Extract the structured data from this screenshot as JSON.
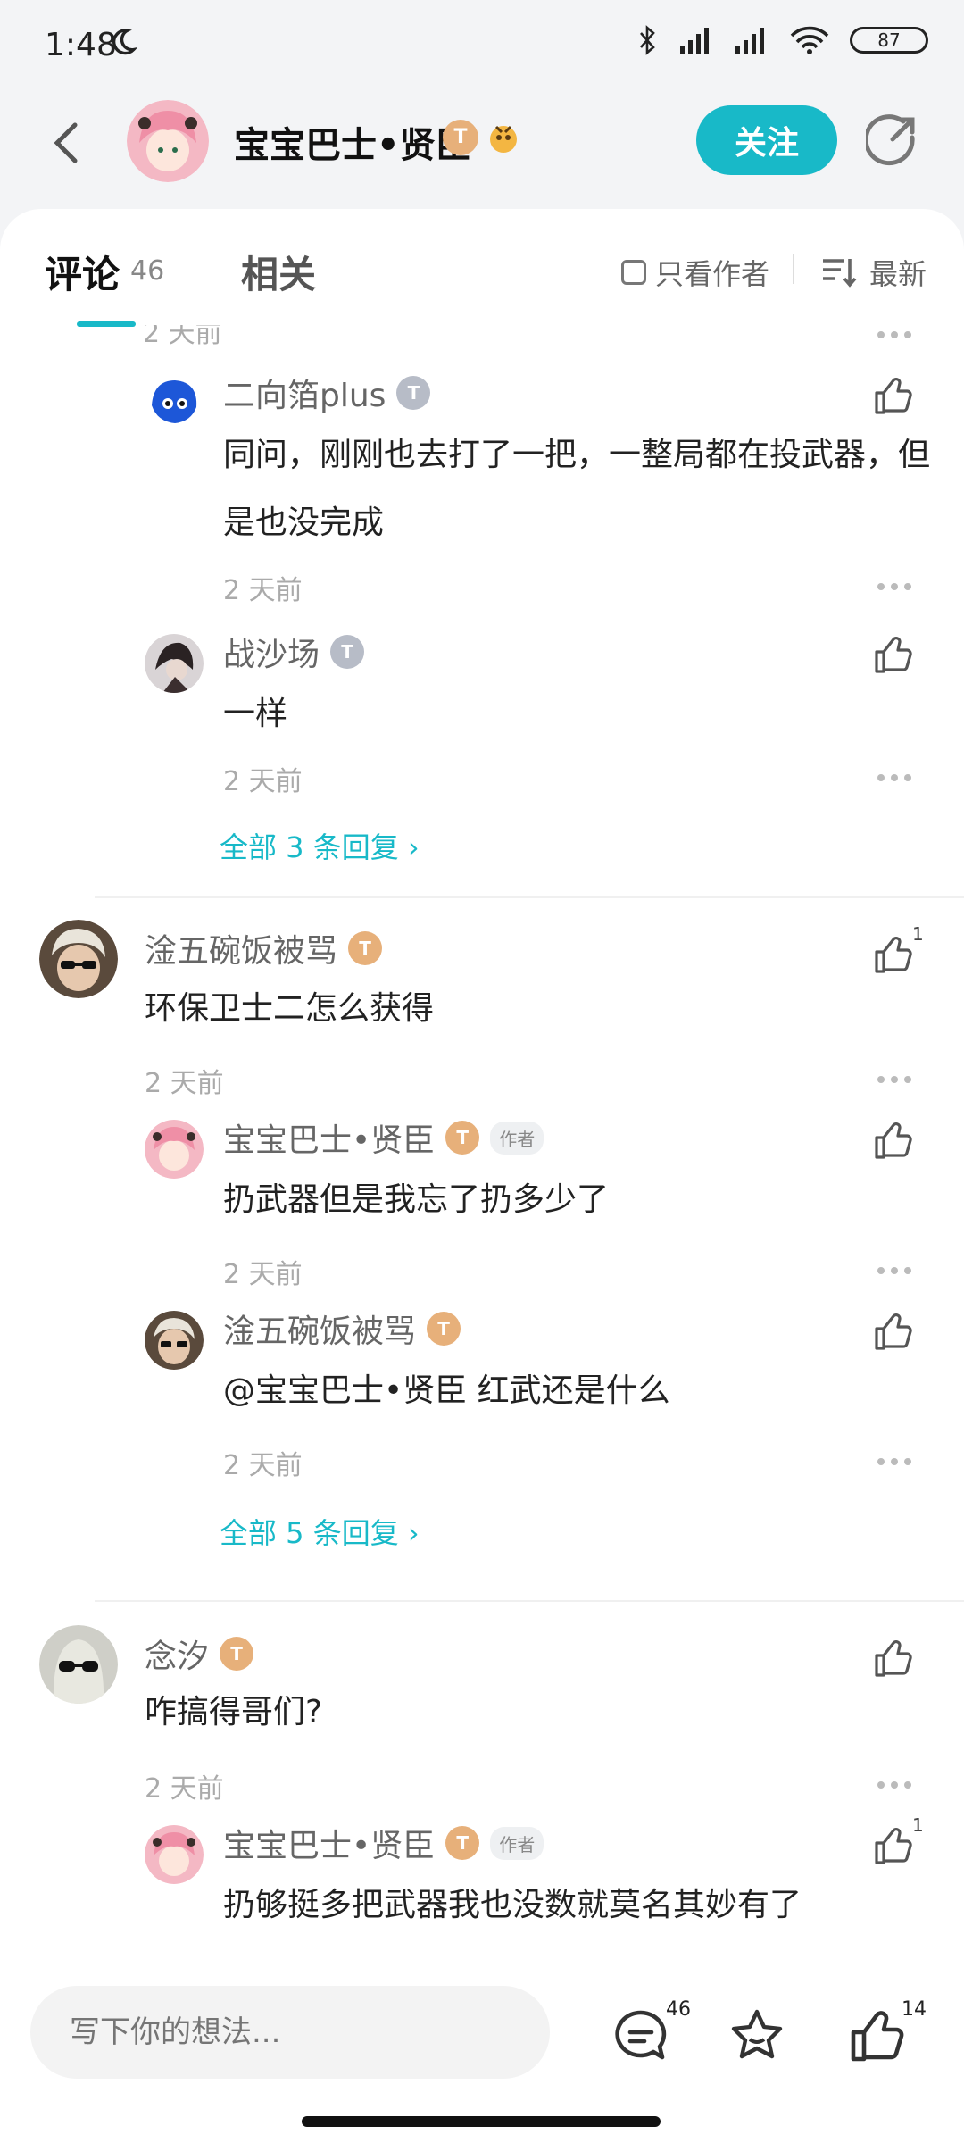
{
  "status": {
    "time": "1:48",
    "battery": "87"
  },
  "header": {
    "name": "宝宝巴士•贤臣",
    "badge": "T",
    "follow_label": "关注"
  },
  "tabs": {
    "comment_label": "评论",
    "comment_count": "46",
    "related_label": "相关",
    "author_only_label": "只看作者",
    "sort_label": "最新"
  },
  "comments": [
    {
      "name": "二向箔plus",
      "badge": "T",
      "text_line1": "同问，刚刚也去打了一把，一整局都在投武器，但",
      "text_line2": "是也没完成",
      "time": "2 天前"
    },
    {
      "name": "战沙场",
      "badge": "T",
      "text": "一样",
      "time": "2 天前"
    },
    {
      "replies_link": "全部 3 条回复 "
    },
    {
      "name": "淦五碗饭被骂",
      "badge": "T",
      "text": "环保卫士二怎么获得",
      "time": "2 天前",
      "likes": "1"
    },
    {
      "name": "宝宝巴士•贤臣",
      "badge": "T",
      "author_tag": "作者",
      "text": "扔武器但是我忘了扔多少了",
      "time": "2 天前"
    },
    {
      "name": "淦五碗饭被骂",
      "badge": "T",
      "text": "@宝宝巴士•贤臣  红武还是什么",
      "time": "2 天前"
    },
    {
      "replies_link": "全部 5 条回复 "
    },
    {
      "name": "念汐",
      "badge": "T",
      "text": "咋搞得哥们?",
      "time": "2 天前"
    },
    {
      "name": "宝宝巴士•贤臣",
      "badge": "T",
      "author_tag": "作者",
      "text": "扔够挺多把武器我也没数就莫名其妙有了",
      "likes": "1"
    }
  ],
  "bottom": {
    "placeholder": "写下你的想法...",
    "comment_count": "46",
    "like_count": "14"
  }
}
